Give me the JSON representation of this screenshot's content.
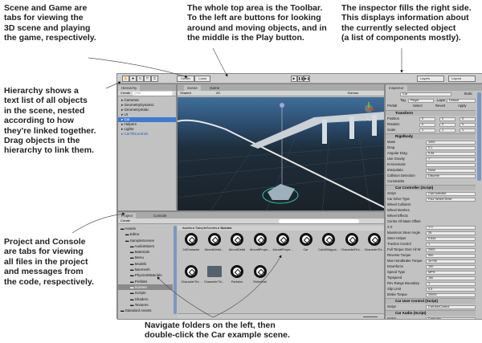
{
  "notes": {
    "scene_game": [
      "Scene and Game are",
      "tabs for viewing the",
      "3D scene and playing",
      "the game, respectively."
    ],
    "toolbar": [
      "The whole top area is the Toolbar.",
      "To the left are buttons for looking",
      "around and moving objects, and in",
      "the middle is the Play button."
    ],
    "inspector": [
      "The inspector fills the right side.",
      "This displays information about",
      "the currently selected object",
      "(a list of components mostly)."
    ],
    "hierarchy": [
      "Hierarchy shows a",
      "text list of all objects",
      "in the scene, nested",
      "according to how",
      "they're linked together.",
      "Drag objects in the",
      "hierarchy to link them."
    ],
    "project": [
      "Project and Console",
      "are tabs for viewing",
      "all files in the project",
      "and messages from",
      "the code, respectively."
    ],
    "navigate": [
      "Navigate folders on the left, then",
      "double-click the Car example scene."
    ]
  },
  "toolbar": {
    "center": "Center",
    "local": "Local",
    "layers": "Layers",
    "layout": "Layout"
  },
  "hierarchy": {
    "tab": "Hierarchy",
    "create": "Create",
    "search": "Q*All",
    "items": [
      {
        "label": "Cameras"
      },
      {
        "label": "GeometryDynamic"
      },
      {
        "label": "GeometryStatic"
      },
      {
        "label": "UI"
      },
      {
        "label": "Car",
        "selected": true
      },
      {
        "label": "Helpers"
      },
      {
        "label": "Lights"
      },
      {
        "label": "CarTiltControls",
        "blue": true
      }
    ]
  },
  "scene": {
    "tabs": [
      "Scene",
      "Game"
    ],
    "shading": "Shaded",
    "mode": "2D",
    "gizmos": "Gizmos",
    "persp": "< Persp"
  },
  "inspector": {
    "tab": "Inspector",
    "name": "Car",
    "static": "Static",
    "tag_label": "Tag",
    "tag": "Player",
    "layer_label": "Layer",
    "layer": "Default",
    "prefab": "Prefab",
    "select": "Select",
    "revert": "Revert",
    "apply": "Apply",
    "transform": {
      "title": "Transform",
      "rows": [
        [
          "Position",
          "0",
          "0",
          "0"
        ],
        [
          "Rotation",
          "0",
          "0",
          "0"
        ],
        [
          "Scale",
          "1",
          "1",
          "1"
        ]
      ]
    },
    "rigidbody": {
      "title": "Rigidbody",
      "rows": [
        [
          "Mass",
          "1000"
        ],
        [
          "Drag",
          "0.1"
        ],
        [
          "Angular Drag",
          "0.05"
        ],
        [
          "Use Gravity",
          "✓"
        ],
        [
          "Is Kinematic",
          ""
        ],
        [
          "Interpolate",
          "None"
        ],
        [
          "Collision Detection",
          "Discrete"
        ],
        [
          "Constraints",
          ""
        ]
      ]
    },
    "car_controller": {
      "title": "Car Controller (Script)",
      "rows": [
        [
          "Script",
          "CarController"
        ],
        [
          "Car Drive Type",
          "Four Wheel Drive"
        ],
        [
          "Wheel Colliders",
          ""
        ],
        [
          "Wheel Meshes",
          ""
        ],
        [
          "Wheel Effects",
          ""
        ],
        [
          "Centre Of Mass Offset",
          ""
        ],
        [
          "X 0",
          "Y 0"
        ],
        [
          "Maximum Steer Angle",
          "25"
        ],
        [
          "Steer Helper",
          "0.644"
        ],
        [
          "Traction Control",
          "1"
        ],
        [
          "Full Torque Over All W",
          "2500"
        ],
        [
          "Reverse Torque",
          "500"
        ],
        [
          "Max Handbrake Torque",
          "1e+08"
        ],
        [
          "Downforce",
          "100"
        ],
        [
          "Speed Type",
          "MPH"
        ],
        [
          "Topspeed",
          "150"
        ],
        [
          "Rev Range Boundary",
          "1"
        ],
        [
          "Slip Limit",
          "0.3"
        ],
        [
          "Brake Torque",
          "20000"
        ]
      ]
    },
    "car_user_control": {
      "title": "Car User Control (Script)",
      "script": "CarUserControl",
      "script_label": "Script"
    },
    "car_audio": {
      "title": "Car Audio (Script)",
      "script": "CarAudio",
      "script_label": "Script"
    }
  },
  "project": {
    "tabs": [
      "Project",
      "Console"
    ],
    "create": "Create",
    "tree": [
      {
        "label": "Assets",
        "d": 0
      },
      {
        "label": "Editor",
        "d": 1
      },
      {
        "label": "SampleScenes",
        "d": 1
      },
      {
        "label": "AudioMixers",
        "d": 2
      },
      {
        "label": "Materials",
        "d": 2
      },
      {
        "label": "Menu",
        "d": 2
      },
      {
        "label": "Models",
        "d": 2
      },
      {
        "label": "Navmesh",
        "d": 2
      },
      {
        "label": "PhysicsMaterials",
        "d": 2
      },
      {
        "label": "Prefabs",
        "d": 2
      },
      {
        "label": "Scenes",
        "d": 2,
        "selected": true
      },
      {
        "label": "Scripts",
        "d": 2
      },
      {
        "label": "Shaders",
        "d": 2
      },
      {
        "label": "Textures",
        "d": 2
      },
      {
        "label": "Standard Assets",
        "d": 0
      }
    ],
    "breadcrumb": [
      "Assets",
      "SampleScenes",
      "Scenes"
    ],
    "assets": [
      {
        "label": "2dCharacter"
      },
      {
        "label": "AircraftJetAI..."
      },
      {
        "label": "AircraftJetAi"
      },
      {
        "label": "AircraftPrope..."
      },
      {
        "label": "AircraftPrope..."
      },
      {
        "label": "Car"
      },
      {
        "label": "CarAIWaypoi..."
      },
      {
        "label": "CharacterFirs..."
      },
      {
        "label": "CharacterThi..."
      },
      {
        "label": "CharacterThi..."
      },
      {
        "label": "CharacterThi...",
        "folder": true
      },
      {
        "label": "Particles"
      },
      {
        "label": "RollerBall"
      }
    ]
  }
}
